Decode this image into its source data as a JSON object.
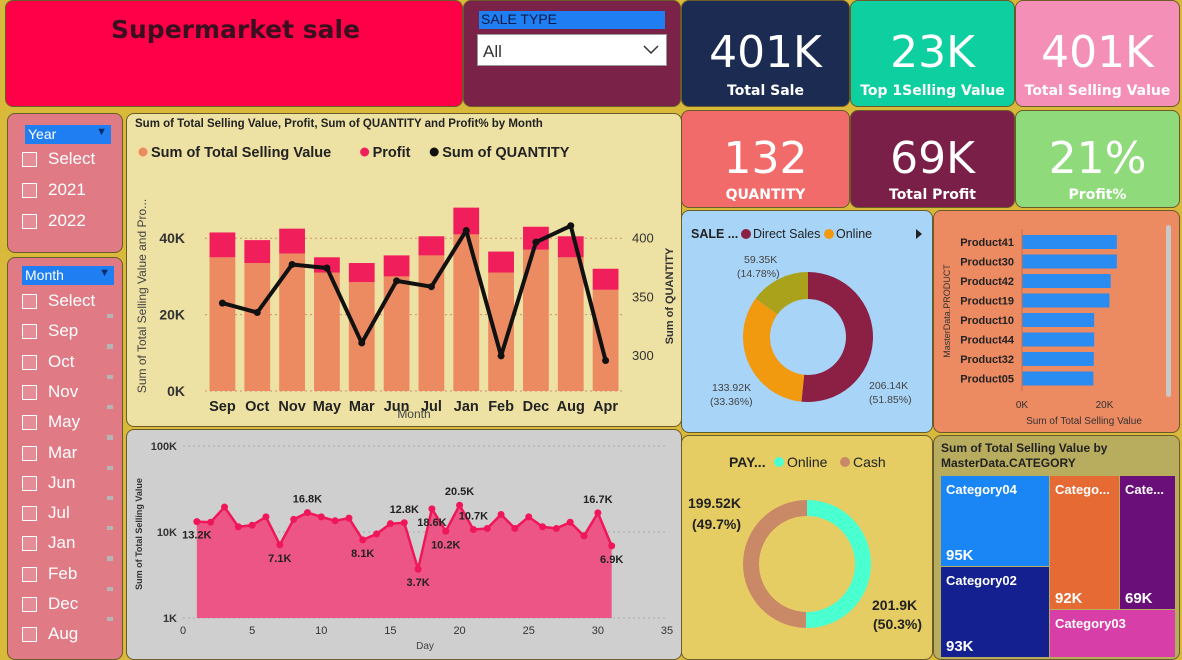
{
  "header": {
    "title": "Supermarket sale"
  },
  "sale_type_slicer": {
    "label": "SALE TYPE",
    "value": "All"
  },
  "kpis": {
    "total_sale": {
      "value": "401K",
      "label": "Total Sale",
      "color": "#1b2b52"
    },
    "top1_selling": {
      "value": "23K",
      "label": "Top 1Selling Value",
      "color": "#0ecfa0"
    },
    "total_selling": {
      "value": "401K",
      "label": "Total Selling Value",
      "color": "#f48fb8"
    },
    "quantity": {
      "value": "132",
      "label": "QUANTITY",
      "color": "#f26b6b"
    },
    "total_profit": {
      "value": "69K",
      "label": "Total Profit",
      "color": "#7a2048"
    },
    "profit_pct": {
      "value": "21%",
      "label": "Profit%",
      "color": "#8fda7a"
    }
  },
  "year_slicer": {
    "title": "Year",
    "items": [
      "Select ...",
      "2021",
      "2022"
    ]
  },
  "month_slicer": {
    "title": "Month",
    "items": [
      "Select all",
      "Sep",
      "Oct",
      "Nov",
      "May",
      "Mar",
      "Jun",
      "Jul",
      "Jan",
      "Feb",
      "Dec",
      "Aug"
    ]
  },
  "colors": {
    "selling_bar": "#ec8a62",
    "profit_bar": "#f01e5a",
    "quantity_line": "#111111",
    "direct_sales": "#8b1f44",
    "online_sale": "#f19a10",
    "third_slice": "#a9a21a",
    "pay_online": "#4affd0",
    "pay_cash": "#c98866",
    "area": "#ec5585",
    "product_bar": "#2a8cf0"
  },
  "chart_data": [
    {
      "id": "combo",
      "type": "bar",
      "title": "Sum of Total Selling Value, Profit, Sum of QUANTITY and Profit% by Month",
      "legend": [
        "Sum of Total Selling Value",
        "Profit",
        "Sum of QUANTITY"
      ],
      "xlabel": "Month",
      "ylabel": "Sum of Total Selling Value and Pro...",
      "y2label": "Sum of QUANTITY",
      "categories": [
        "Sep",
        "Oct",
        "Nov",
        "May",
        "Mar",
        "Jun",
        "Jul",
        "Jan",
        "Feb",
        "Dec",
        "Aug",
        "Apr"
      ],
      "series": [
        {
          "name": "Sum of Total Selling Value",
          "values": [
            35000,
            33500,
            36000,
            31000,
            28500,
            30000,
            35500,
            41000,
            31000,
            37000,
            35000,
            26500
          ]
        },
        {
          "name": "Profit",
          "values": [
            6500,
            6000,
            6500,
            4000,
            5000,
            5500,
            5000,
            7000,
            5500,
            6000,
            5500,
            5500
          ]
        },
        {
          "name": "Sum of QUANTITY",
          "values": [
            345,
            337,
            378,
            375,
            311,
            364,
            359,
            407,
            300,
            397,
            411,
            296
          ]
        }
      ],
      "yticks": [
        "0K",
        "20K",
        "40K"
      ],
      "ylim": [
        0,
        50000
      ],
      "y2ticks": [
        "300",
        "350",
        "400"
      ],
      "y2lim": [
        270,
        433
      ]
    },
    {
      "id": "sale_type_donut",
      "type": "pie",
      "title": "SALE ...",
      "legend": [
        "Direct Sales",
        "Online"
      ],
      "slices": [
        {
          "name": "Direct Sales",
          "value": 206140,
          "label": "206.14K",
          "pct": "(51.85%)"
        },
        {
          "name": "Online",
          "value": 133920,
          "label": "133.92K",
          "pct": "(33.36%)"
        },
        {
          "name": "",
          "value": 59350,
          "label": "59.35K",
          "pct": "(14.78%)"
        }
      ]
    },
    {
      "id": "product_bars",
      "type": "bar",
      "ylabel": "MasterData.PRODUCT",
      "xlabel": "Sum of Total Selling Value",
      "xticks": [
        "0K",
        "20K"
      ],
      "xlim": [
        0,
        32000
      ],
      "categories": [
        "Product41",
        "Product30",
        "Product42",
        "Product19",
        "Product10",
        "Product44",
        "Product32",
        "Product05"
      ],
      "values": [
        23000,
        23000,
        21500,
        21200,
        17500,
        17500,
        17400,
        17300
      ]
    },
    {
      "id": "daily_area",
      "type": "area",
      "ylabel": "Sum of Total Selling Value",
      "xlabel": "Day",
      "log_scale": true,
      "yticks": [
        "1K",
        "10K",
        "100K"
      ],
      "xticks": [
        "0",
        "5",
        "10",
        "15",
        "20",
        "25",
        "30",
        "35"
      ],
      "xlim": [
        0,
        35
      ],
      "x": [
        1,
        2,
        3,
        4,
        5,
        6,
        7,
        8,
        9,
        10,
        11,
        12,
        13,
        14,
        15,
        16,
        17,
        18,
        19,
        20,
        21,
        22,
        23,
        24,
        25,
        26,
        27,
        28,
        29,
        30,
        31
      ],
      "values": [
        13200,
        13000,
        19500,
        11500,
        12000,
        15000,
        7100,
        14000,
        16800,
        15000,
        13500,
        14500,
        8100,
        9500,
        12500,
        12800,
        3700,
        18600,
        10200,
        20500,
        10700,
        11000,
        16000,
        11000,
        15000,
        11500,
        11000,
        13000,
        9000,
        16700,
        6900
      ],
      "labels": [
        {
          "day": 1,
          "text": "13.2K",
          "pos": "below"
        },
        {
          "day": 7,
          "text": "7.1K",
          "pos": "below"
        },
        {
          "day": 9,
          "text": "16.8K",
          "pos": "above"
        },
        {
          "day": 13,
          "text": "8.1K",
          "pos": "below"
        },
        {
          "day": 16,
          "text": "12.8K",
          "pos": "above"
        },
        {
          "day": 17,
          "text": "3.7K",
          "pos": "below"
        },
        {
          "day": 18,
          "text": "18.6K",
          "pos": "below"
        },
        {
          "day": 19,
          "text": "10.2K",
          "pos": "below"
        },
        {
          "day": 20,
          "text": "20.5K",
          "pos": "above"
        },
        {
          "day": 21,
          "text": "10.7K",
          "pos": "above"
        },
        {
          "day": 30,
          "text": "16.7K",
          "pos": "above"
        },
        {
          "day": 31,
          "text": "6.9K",
          "pos": "below"
        }
      ]
    },
    {
      "id": "payment_donut",
      "type": "pie",
      "title": "PAY...",
      "legend": [
        "Online",
        "Cash"
      ],
      "slices": [
        {
          "name": "Online",
          "value": 201900,
          "label": "201.9K",
          "pct": "(50.3%)"
        },
        {
          "name": "Cash",
          "value": 199520,
          "label": "199.52K",
          "pct": "(49.7%)"
        }
      ]
    },
    {
      "id": "category_treemap",
      "type": "heatmap",
      "title": "Sum of Total Selling Value by MasterData.CATEGORY",
      "cells": [
        {
          "name": "Category04",
          "value": "95K",
          "color": "#1a86f5"
        },
        {
          "name": "Catego...",
          "value": "92K",
          "color": "#e56a33"
        },
        {
          "name": "Cate...",
          "value": "69K",
          "color": "#6a0f7a"
        },
        {
          "name": "Category02",
          "value": "93K",
          "color": "#14208f"
        },
        {
          "name": "Category03",
          "value": "",
          "color": "#d83ea8"
        }
      ]
    }
  ]
}
